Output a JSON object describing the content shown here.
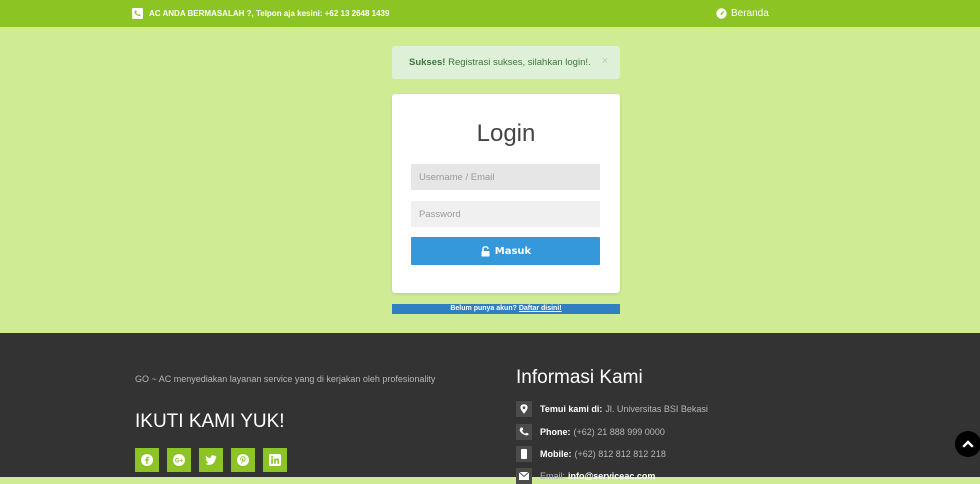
{
  "topbar": {
    "contact_text": "AC ANDA BERMASALAH ?, Telpon aja kesini: +62 13 2648 1439",
    "home_link": "Beranda"
  },
  "alert": {
    "title": "Sukses!",
    "message": "Registrasi sukses, silahkan login!.",
    "close": "×"
  },
  "login": {
    "title": "Login",
    "username_placeholder": "Username / Email",
    "password_placeholder": "Password",
    "submit_label": "Masuk"
  },
  "register": {
    "prompt": "Belum punya akun?",
    "link_text": "Daftar disini!"
  },
  "footer": {
    "about": "GO ~ AC menyediakan layanan service yang di kerjakan oleh profesionality",
    "follow_title": "IKUTI KAMI YUK!",
    "social_icons": [
      "facebook-icon",
      "google-plus-icon",
      "twitter-icon",
      "pinterest-icon",
      "linkedin-icon"
    ],
    "info_title": "Informasi Kami",
    "info": [
      {
        "icon": "map-marker-icon",
        "label": "Temui kami di:",
        "value": "Jl. Universitas BSI Bekasi"
      },
      {
        "icon": "phone-icon",
        "label": "Phone:",
        "value": "(+62) 21 888 999 0000"
      },
      {
        "icon": "mobile-icon",
        "label": "Mobile:",
        "value": "(+62) 812 812 812 218"
      },
      {
        "icon": "envelope-icon",
        "label": "Email:",
        "value": "info@serviceac.com"
      }
    ]
  },
  "colors": {
    "topbar": "#8cc423",
    "background": "#cfec95",
    "footer": "#333333",
    "button": "#3498db"
  }
}
